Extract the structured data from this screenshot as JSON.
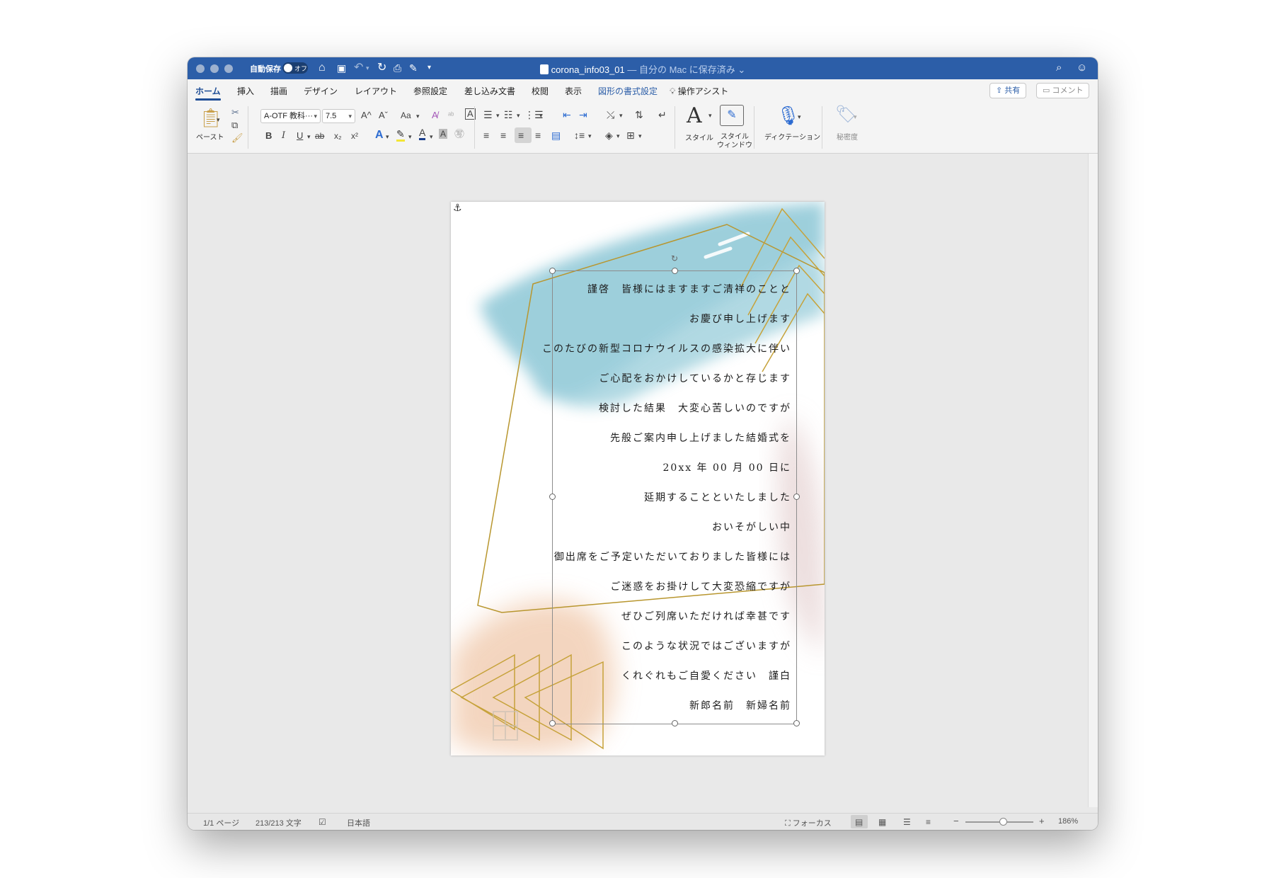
{
  "window": {
    "autosave_label": "自動保存",
    "autosave_state": "オフ",
    "file_name": "corona_info03_01",
    "save_status": " — 自分の Mac に保存済み",
    "chevron": "⌄"
  },
  "tabs": [
    {
      "label": "ホーム"
    },
    {
      "label": "挿入"
    },
    {
      "label": "描画"
    },
    {
      "label": "デザイン"
    },
    {
      "label": "レイアウト"
    },
    {
      "label": "参照設定"
    },
    {
      "label": "差し込み文書"
    },
    {
      "label": "校閲"
    },
    {
      "label": "表示"
    },
    {
      "label": "図形の書式設定"
    },
    {
      "label": "操作アシスト"
    }
  ],
  "header_buttons": {
    "share": "共有",
    "comment": "コメント"
  },
  "ribbon": {
    "paste_label": "ペースト",
    "font_name": "A-OTF 教科···",
    "font_size": "7.5",
    "grow_font": "A^",
    "shrink_font": "Aˇ",
    "change_case": "Aa",
    "bold": "B",
    "italic": "I",
    "underline": "U",
    "strike": "ab",
    "subscript": "x₂",
    "superscript": "x²",
    "styles_label": "スタイル",
    "style_window_label_1": "スタイル",
    "style_window_label_2": "ウィンドウ",
    "dictation_label": "ディクテーション",
    "sensitivity_label": "秘密度"
  },
  "document": {
    "lines": [
      "謹啓　皆様にはますますご清祥のことと",
      "お慶び申し上げます",
      "このたびの新型コロナウイルスの感染拡大に伴い",
      "ご心配をおかけしているかと存じます",
      "検討した結果　大変心苦しいのですが",
      "先般ご案内申し上げました結婚式を",
      "20xx 年 00 月 00 日に",
      "延期することといたしました",
      "おいそがしい中",
      "御出席をご予定いただいておりました皆様には",
      "ご迷惑をお掛けして大変恐縮ですが",
      "ぜひご列席いただければ幸甚です",
      "このような状況ではございますが",
      "くれぐれもご自愛ください　謹白",
      "新郎名前　新婦名前"
    ]
  },
  "status": {
    "page": "1/1 ページ",
    "words": "213/213 文字",
    "language": "日本語",
    "focus": "フォーカス",
    "zoom": "186%",
    "zoom_level": 0.55
  },
  "colors": {
    "titlebar": "#2c5ea8",
    "accent": "#1f4e96",
    "gold": "#b8962e",
    "watercolor_blue": "#7dbfd0",
    "watercolor_peach": "#efc4a4",
    "watercolor_rose": "#dcc1c1"
  }
}
